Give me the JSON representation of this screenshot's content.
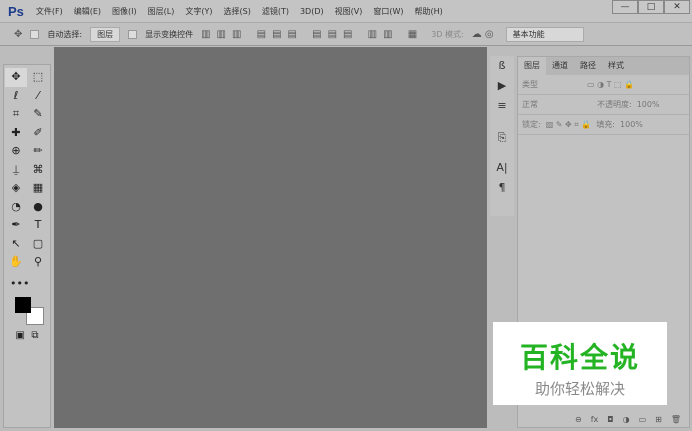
{
  "app": {
    "logo": "Ps"
  },
  "menu": [
    "文件(F)",
    "编辑(E)",
    "图像(I)",
    "图层(L)",
    "文字(Y)",
    "选择(S)",
    "滤镜(T)",
    "3D(D)",
    "视图(V)",
    "窗口(W)",
    "帮助(H)"
  ],
  "window": {
    "minimize": "—",
    "maximize": "□",
    "close": "✕"
  },
  "options": {
    "auto_select_label": "自动选择:",
    "auto_select_value": "图层",
    "show_transform_label": "显示变换控件",
    "mode_3d": "3D 模式:",
    "workspace": "基本功能"
  },
  "tools": [
    "✥",
    "⬚",
    "ℓ",
    "⁄",
    "⌗",
    "✎",
    "✚",
    "✐",
    "⊕",
    "✏",
    "⍊",
    "⌘",
    "◈",
    "▦",
    "◔",
    "●",
    "✒",
    "T",
    "↖",
    "▢",
    "✋",
    "⚲"
  ],
  "extras": "•••",
  "colors": {
    "foreground": "#000000",
    "background": "#ffffff",
    "canvas": "#6f6f6f",
    "watermark_green": "#23b323"
  },
  "dock": [
    "ß",
    "▶",
    "≡",
    "⎘",
    "A|",
    "¶"
  ],
  "panel": {
    "tabs": [
      "图层",
      "通道",
      "路径",
      "样式"
    ],
    "filter_kind": "类型",
    "blend_mode": "正常",
    "opacity_label": "不透明度:",
    "opacity": "100%",
    "lock_label": "锁定:",
    "fill_label": "填充:",
    "fill": "100%",
    "footer": [
      "⊖",
      "fx",
      "◘",
      "◑",
      "▭",
      "⊞",
      "🗑"
    ]
  },
  "watermark": {
    "title": "百科全说",
    "subtitle": "助你轻松解决"
  }
}
